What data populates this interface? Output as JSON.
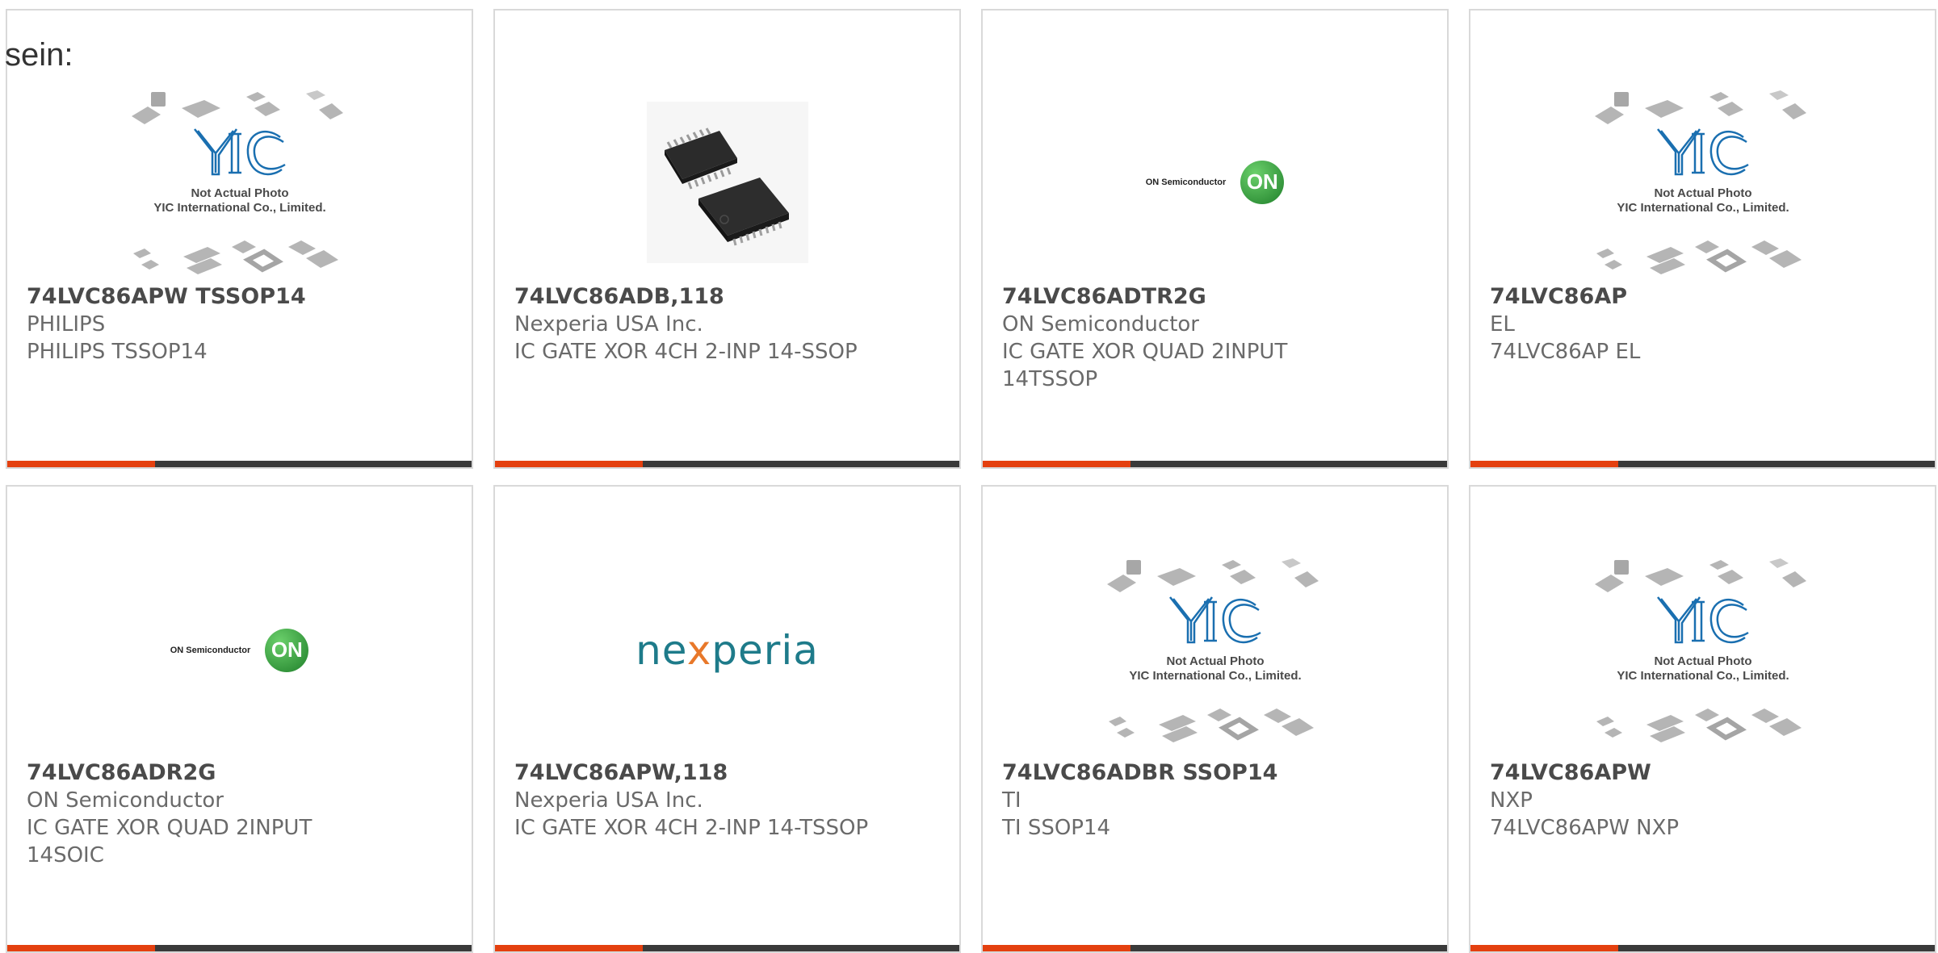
{
  "intro_text": "sein:",
  "colors": {
    "accent": "#e4400f",
    "bar": "#3a3a3a",
    "yic_blue": "#1a6fb0",
    "on_green": "#2f9a3a",
    "nexperia_teal": "#1e7b8a"
  },
  "placeholder_caption": {
    "line1": "Not Actual Photo",
    "line2": "YIC International Co., Limited."
  },
  "logos": {
    "yic": "YIC",
    "on_text": "ON Semiconductor",
    "on_badge": "ON",
    "nexperia_pre": "ne",
    "nexperia_x": "x",
    "nexperia_post": "peria"
  },
  "products": [
    {
      "part": "74LVC86APW TSSOP14",
      "manufacturer": "PHILIPS",
      "description": "PHILIPS TSSOP14",
      "image": "yic-placeholder"
    },
    {
      "part": "74LVC86ADB,118",
      "manufacturer": "Nexperia USA Inc.",
      "description": "IC GATE XOR 4CH 2-INP 14-SSOP",
      "image": "chip-photo"
    },
    {
      "part": "74LVC86ADTR2G",
      "manufacturer": "ON Semiconductor",
      "description": "IC GATE XOR QUAD 2INPUT 14TSSOP",
      "image": "on-semiconductor-logo"
    },
    {
      "part": "74LVC86AP",
      "manufacturer": "EL",
      "description": "74LVC86AP EL",
      "image": "yic-placeholder"
    },
    {
      "part": "74LVC86ADR2G",
      "manufacturer": "ON Semiconductor",
      "description": "IC GATE XOR QUAD 2INPUT 14SOIC",
      "image": "on-semiconductor-logo"
    },
    {
      "part": "74LVC86APW,118",
      "manufacturer": "Nexperia USA Inc.",
      "description": "IC GATE XOR 4CH 2-INP 14-TSSOP",
      "image": "nexperia-logo"
    },
    {
      "part": "74LVC86ADBR SSOP14",
      "manufacturer": "TI",
      "description": "TI SSOP14",
      "image": "yic-placeholder"
    },
    {
      "part": "74LVC86APW",
      "manufacturer": "NXP",
      "description": "74LVC86APW NXP",
      "image": "yic-placeholder"
    }
  ]
}
